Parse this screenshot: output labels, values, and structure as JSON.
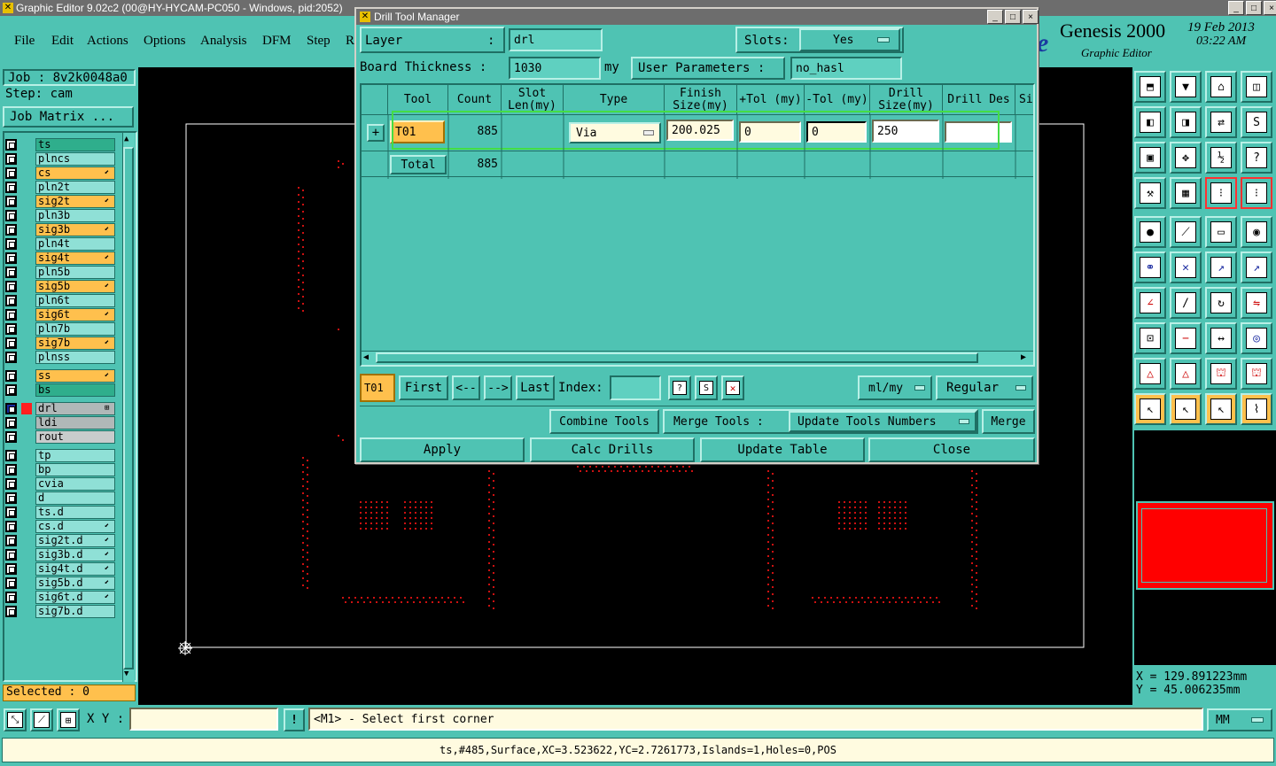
{
  "window": {
    "title": "Graphic Editor 9.02c2 (00@HY-HYCAM-PC050 - Windows, pid:2052)",
    "min": "_",
    "max": "□",
    "close": "×"
  },
  "menu": [
    "File",
    "Edit",
    "Actions",
    "Options",
    "Analysis",
    "DFM",
    "Step",
    "R"
  ],
  "brand": {
    "logo_letter": "e",
    "name": "Genesis 2000",
    "subtitle": "Graphic Editor",
    "date": "19 Feb 2013",
    "time": "03:22 AM"
  },
  "left": {
    "job": "Job : 8v2k0048a0",
    "step": "Step: cam",
    "job_matrix": "Job Matrix ...",
    "selected": "Selected : 0",
    "layers": [
      {
        "name": "ts",
        "color": "#2fae8c"
      },
      {
        "name": "plncs",
        "color": "#8fe0d6"
      },
      {
        "name": "cs",
        "color": "#ffc04d",
        "mark": "⬋"
      },
      {
        "name": "pln2t",
        "color": "#8fe0d6"
      },
      {
        "name": "sig2t",
        "color": "#ffc04d",
        "mark": "⬋"
      },
      {
        "name": "pln3b",
        "color": "#8fe0d6"
      },
      {
        "name": "sig3b",
        "color": "#ffc04d",
        "mark": "⬋"
      },
      {
        "name": "pln4t",
        "color": "#8fe0d6"
      },
      {
        "name": "sig4t",
        "color": "#ffc04d",
        "mark": "⬋"
      },
      {
        "name": "pln5b",
        "color": "#8fe0d6"
      },
      {
        "name": "sig5b",
        "color": "#ffc04d",
        "mark": "⬋"
      },
      {
        "name": "pln6t",
        "color": "#8fe0d6"
      },
      {
        "name": "sig6t",
        "color": "#ffc04d",
        "mark": "⬋"
      },
      {
        "name": "pln7b",
        "color": "#8fe0d6"
      },
      {
        "name": "sig7b",
        "color": "#ffc04d",
        "mark": "⬋"
      },
      {
        "name": "plnss",
        "color": "#8fe0d6"
      },
      {
        "name": "ss",
        "color": "#ffc04d",
        "mark": "⬋"
      },
      {
        "name": "bs",
        "color": "#2fae8c"
      },
      {
        "name": "drl",
        "color": "#b0b8b8",
        "mark": "⊞"
      },
      {
        "name": "ldi",
        "color": "#b0b8b8"
      },
      {
        "name": "rout",
        "color": "#c8cccc"
      },
      {
        "name": "tp",
        "color": "#8fe0d6"
      },
      {
        "name": "bp",
        "color": "#8fe0d6"
      },
      {
        "name": "cvia",
        "color": "#8fe0d6"
      },
      {
        "name": "d",
        "color": "#8fe0d6"
      },
      {
        "name": "ts.d",
        "color": "#8fe0d6"
      },
      {
        "name": "cs.d",
        "color": "#8fe0d6",
        "mark": "⬋"
      },
      {
        "name": "sig2t.d",
        "color": "#8fe0d6",
        "mark": "⬋"
      },
      {
        "name": "sig3b.d",
        "color": "#8fe0d6",
        "mark": "⬋"
      },
      {
        "name": "sig4t.d",
        "color": "#8fe0d6",
        "mark": "⬋"
      },
      {
        "name": "sig5b.d",
        "color": "#8fe0d6",
        "mark": "⬋"
      },
      {
        "name": "sig6t.d",
        "color": "#8fe0d6",
        "mark": "⬋"
      },
      {
        "name": "sig7b.d",
        "color": "#8fe0d6"
      }
    ]
  },
  "dialog": {
    "title": "Drill Tool Manager",
    "layer_label": "Layer",
    "layer_colon": ":",
    "layer_value": "drl",
    "slots_label": "Slots:",
    "slots_value": "Yes",
    "thickness_label": "Board Thickness :",
    "thickness_value": "1030",
    "thickness_unit": "my",
    "user_params_label": "User Parameters :",
    "user_params_value": "no_hasl",
    "columns": [
      "Tool",
      "Count",
      "Slot Len(my)",
      "Type",
      "Finish Size(my)",
      "+Tol (my)",
      "-Tol (my)",
      "Drill Size(my)",
      "Drill Des",
      "Si"
    ],
    "row": {
      "tool": "T01",
      "count": "885",
      "type": "Via",
      "finish": "200.025",
      "ptol": "0",
      "mtol": "0",
      "drill": "250",
      "des": ""
    },
    "total_label": "Total",
    "total_count": "885",
    "nav": {
      "current": "T01",
      "first": "First",
      "prev": "<--",
      "next": "-->",
      "last": "Last",
      "index_label": "Index:",
      "index_value": "",
      "units": "ml/my",
      "mode": "Regular"
    },
    "combine_tools": "Combine Tools",
    "merge_tools_label": "Merge Tools :",
    "merge_option": "Update Tools Numbers",
    "merge": "Merge",
    "apply": "Apply",
    "calc_drills": "Calc Drills",
    "update_table": "Update Table",
    "close": "Close"
  },
  "coords": {
    "x": "X  = 129.891223mm",
    "y": "Y  =  45.006235mm"
  },
  "command": {
    "xy_label": "X Y :",
    "xy_value": "",
    "info_icon": "!",
    "prompt": "<M1> - Select first corner",
    "units": "MM"
  },
  "status": "ts,#485,Surface,XC=3.523622,YC=2.7261773,Islands=1,Holes=0,POS",
  "colors": {
    "panel": "#4fc3b3",
    "highlight_row": "#44dd44",
    "drill_dot": "#cc1111",
    "yellow_field": "#fffbe0",
    "tool_orange": "#ffc04d"
  }
}
